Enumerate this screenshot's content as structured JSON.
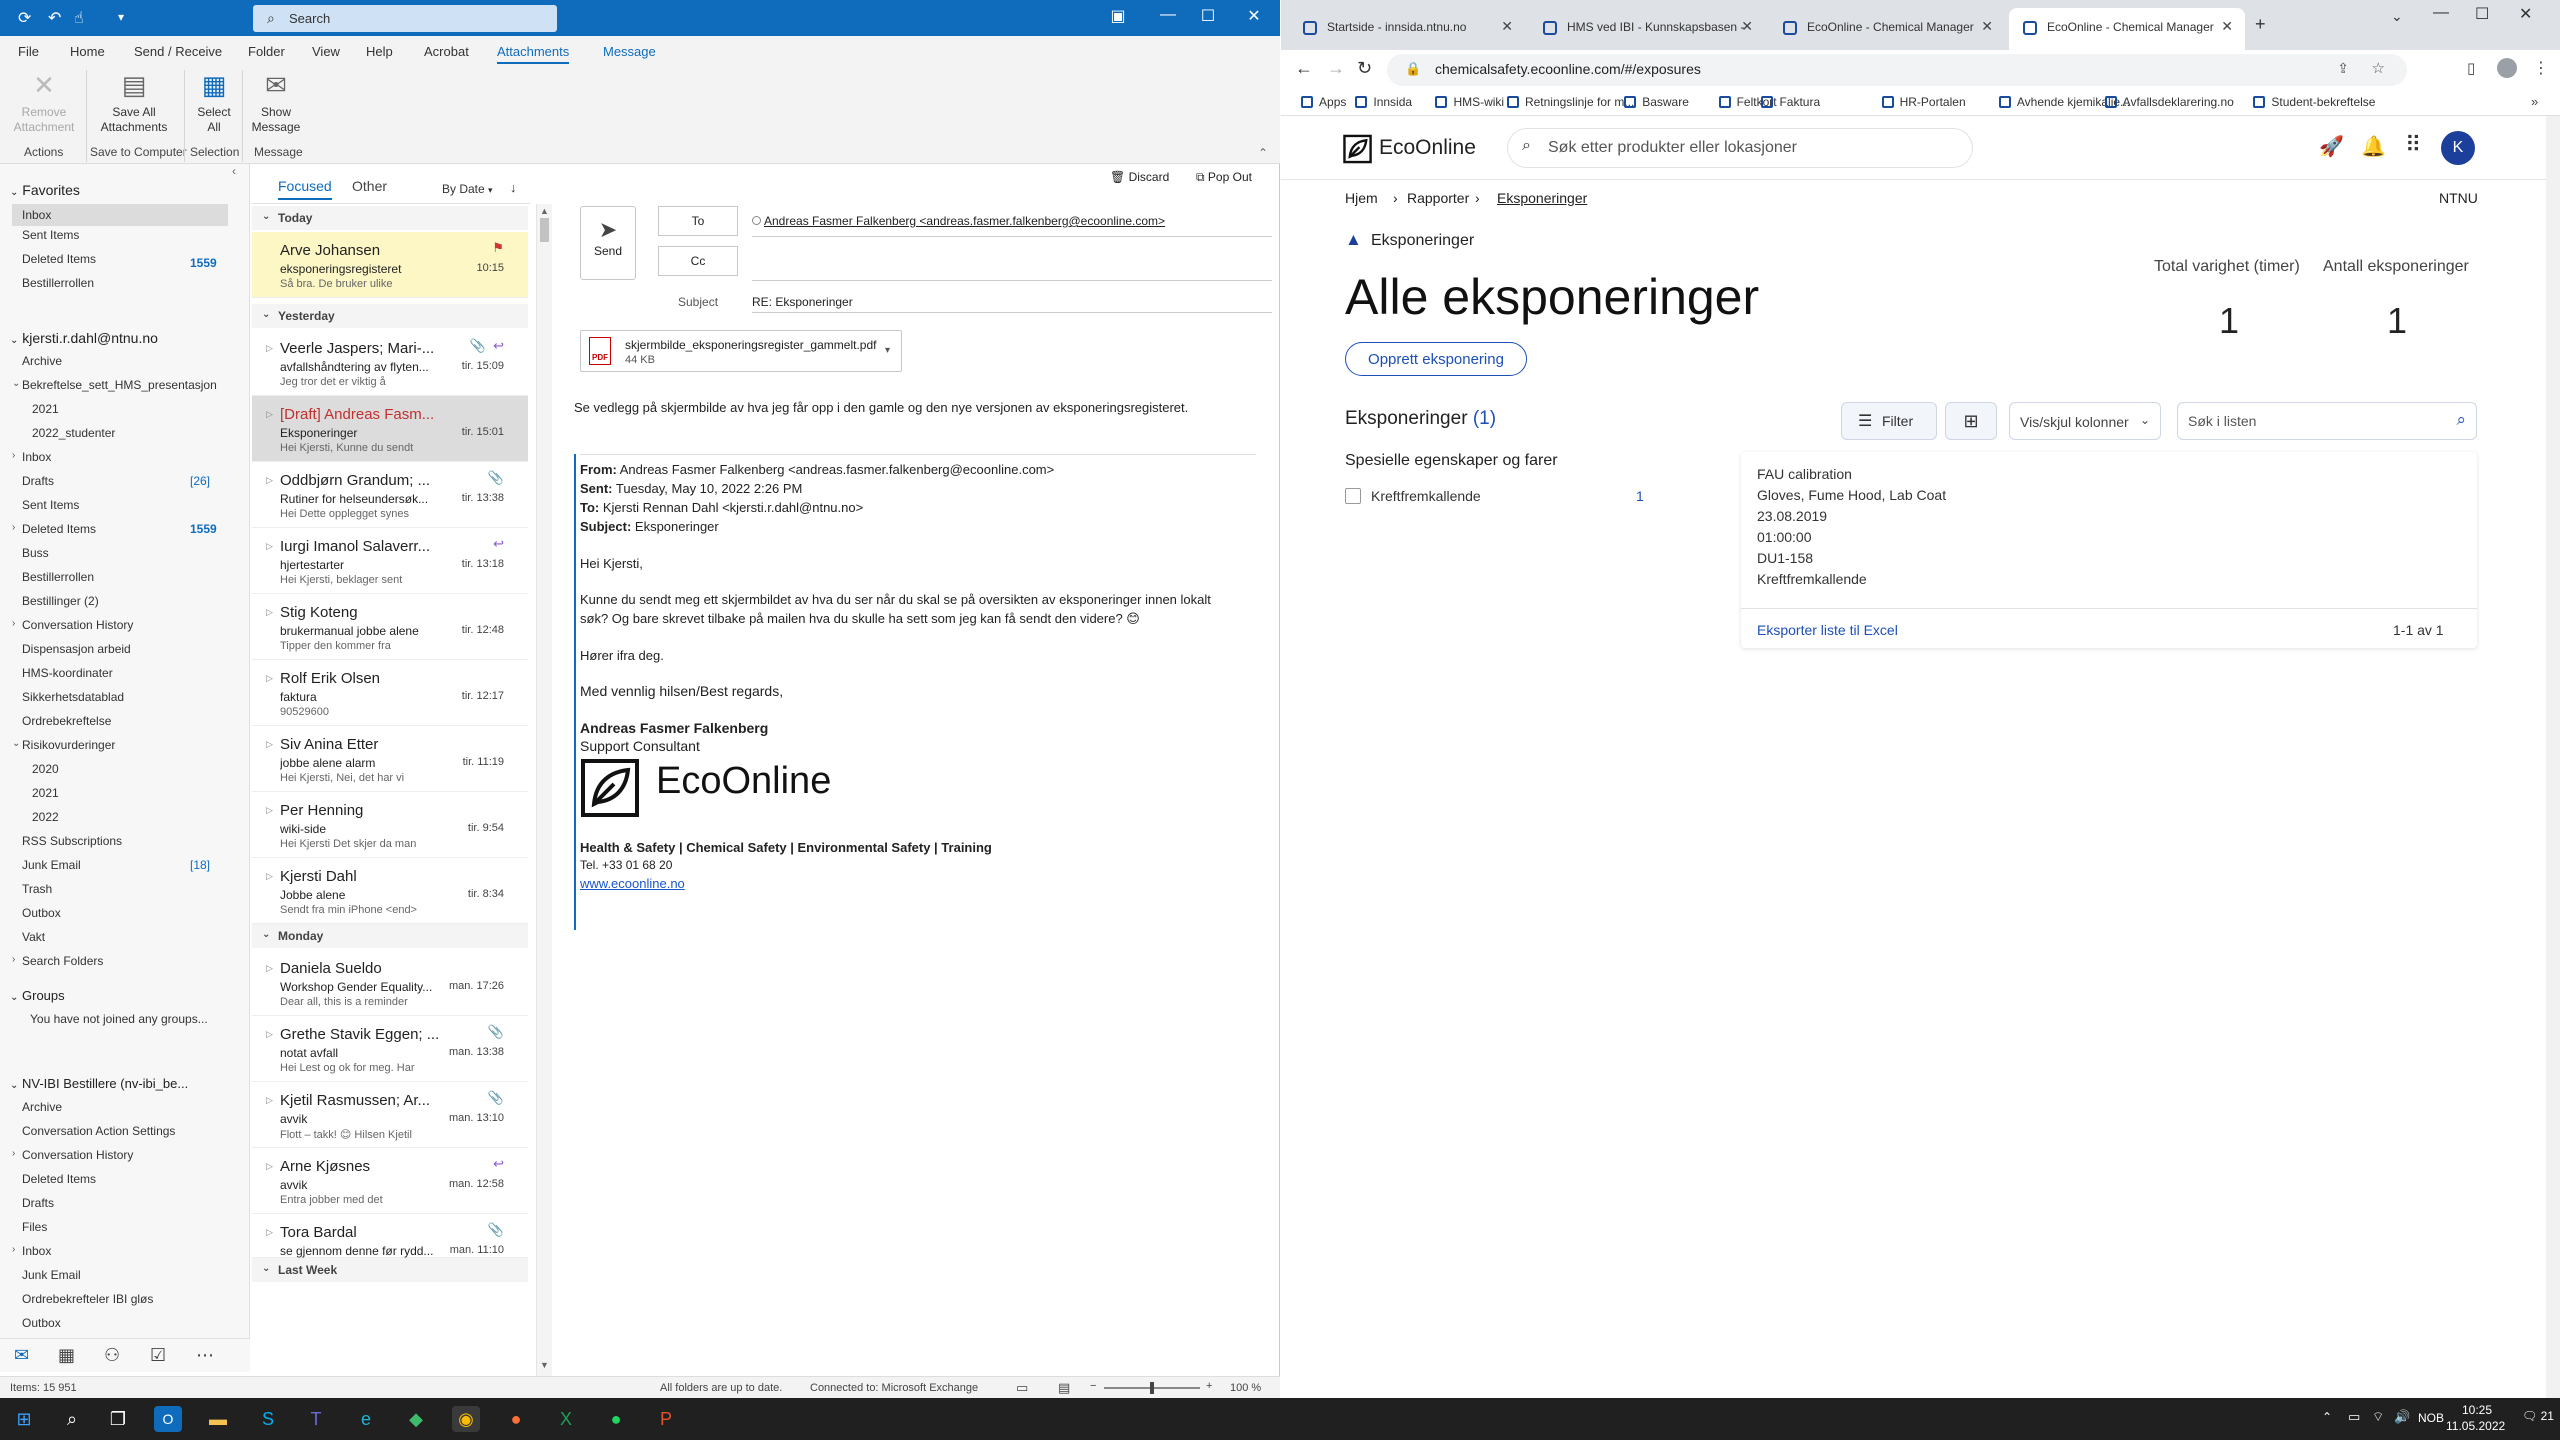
{
  "outlook": {
    "search_placeholder": "Search",
    "menu": [
      "File",
      "Home",
      "Send / Receive",
      "Folder",
      "View",
      "Help",
      "Acrobat",
      "Attachments",
      "Message"
    ],
    "ribbon": {
      "remove_attachment": "Remove\nAttachment",
      "save_all": "Save All\nAttachments",
      "select_all": "Select\nAll",
      "show_message": "Show\nMessage",
      "groups": [
        "Actions",
        "Save to Computer",
        "Selection",
        "Message"
      ]
    },
    "favorites_label": "Favorites",
    "favorites": [
      {
        "label": "Inbox"
      },
      {
        "label": "Sent Items"
      },
      {
        "label": "Deleted Items",
        "count": "1559"
      },
      {
        "label": "Bestillerrollen"
      }
    ],
    "account": "kjersti.r.dahl@ntnu.no",
    "folders": [
      {
        "label": "Archive",
        "indent": 1
      },
      {
        "label": "Bekreftelse_sett_HMS_presentasjon",
        "indent": 1,
        "exp": "v"
      },
      {
        "label": "2021",
        "indent": 2
      },
      {
        "label": "2022_studenter",
        "indent": 2
      },
      {
        "label": "Inbox",
        "indent": 1,
        "exp": ">"
      },
      {
        "label": "Drafts",
        "indent": 1,
        "count": "[26]",
        "bracket": true
      },
      {
        "label": "Sent Items",
        "indent": 1
      },
      {
        "label": "Deleted Items",
        "indent": 1,
        "exp": ">",
        "count": "1559"
      },
      {
        "label": "Buss",
        "indent": 1
      },
      {
        "label": "Bestillerrollen",
        "indent": 1
      },
      {
        "label": "Bestillinger (2)",
        "indent": 1
      },
      {
        "label": "Conversation History",
        "indent": 1,
        "exp": ">"
      },
      {
        "label": "Dispensasjon arbeid",
        "indent": 1
      },
      {
        "label": "HMS-koordinater",
        "indent": 1
      },
      {
        "label": "Sikkerhetsdatablad",
        "indent": 1
      },
      {
        "label": "Ordrebekreftelse",
        "indent": 1
      },
      {
        "label": "Risikovurderinger",
        "indent": 1,
        "exp": "v"
      },
      {
        "label": "2020",
        "indent": 2
      },
      {
        "label": "2021",
        "indent": 2
      },
      {
        "label": "2022",
        "indent": 2
      },
      {
        "label": "RSS Subscriptions",
        "indent": 1
      },
      {
        "label": "Junk Email",
        "indent": 1,
        "count": "[18]",
        "bracket": true
      },
      {
        "label": "Trash",
        "indent": 1
      },
      {
        "label": "Outbox",
        "indent": 1
      },
      {
        "label": "Vakt",
        "indent": 1
      },
      {
        "label": "Search Folders",
        "indent": 1,
        "exp": ">"
      }
    ],
    "groups_label": "Groups",
    "groups_note": "You have not joined any groups...",
    "shared_account": "NV-IBI Bestillere (nv-ibi_be...",
    "shared_folders": [
      {
        "label": "Archive"
      },
      {
        "label": "Conversation Action Settings"
      },
      {
        "label": "Conversation History",
        "exp": ">"
      },
      {
        "label": "Deleted Items"
      },
      {
        "label": "Drafts"
      },
      {
        "label": "Files"
      },
      {
        "label": "Inbox",
        "exp": ">"
      },
      {
        "label": "Junk Email"
      },
      {
        "label": "Ordrebekrefteler IBI gløs"
      },
      {
        "label": "Outbox"
      }
    ],
    "list": {
      "tab_focused": "Focused",
      "tab_other": "Other",
      "sort": "By Date",
      "groups": [
        "Today",
        "Yesterday",
        "Monday",
        "Last Week"
      ],
      "items": [
        {
          "sender": "Arve Johansen",
          "subject": "eksponeringsregisteret",
          "preview": "Så bra. De bruker ulike",
          "time": "10:15",
          "flag": true
        },
        {
          "sender": "Veerle Jaspers;  Mari-...",
          "subject": "avfallshåndtering av flyten...",
          "preview": "Jeg tror det er viktig å",
          "time": "tir. 15:09",
          "att": true,
          "reply": true
        },
        {
          "sender": "[Draft] Andreas Fasm...",
          "subject": "Eksponeringer",
          "preview": "Hei Kjersti,   Kunne du sendt",
          "time": "tir. 15:01",
          "draft": true
        },
        {
          "sender": "Oddbjørn Grandum;  ...",
          "subject": "Rutiner for helseundersøk...",
          "preview": "Hei  Dette opplegget synes",
          "time": "tir. 13:38",
          "att": true
        },
        {
          "sender": "Iurgi Imanol Salaverr...",
          "subject": "hjertestarter",
          "preview": "Hei Kjersti, beklager sent",
          "time": "tir. 13:18",
          "reply": true
        },
        {
          "sender": "Stig Koteng",
          "subject": "brukermanual jobbe alene",
          "preview": "Tipper den kommer fra",
          "time": "tir. 12:48"
        },
        {
          "sender": "Rolf Erik Olsen",
          "subject": "faktura",
          "preview": "90529600",
          "time": "tir. 12:17"
        },
        {
          "sender": "Siv Anina Etter",
          "subject": "jobbe alene alarm",
          "preview": "Hei Kjersti,  Nei, det har vi",
          "time": "tir. 11:19"
        },
        {
          "sender": "Per Henning",
          "subject": "wiki-side",
          "preview": "Hei Kjersti  Det skjer da man",
          "time": "tir. 9:54"
        },
        {
          "sender": "Kjersti Dahl",
          "subject": "Jobbe alene",
          "preview": "Sendt fra min iPhone <end>",
          "time": "tir. 8:34"
        },
        {
          "sender": "Daniela Sueldo",
          "subject": "Workshop Gender Equality...",
          "preview": "Dear all,  this is a reminder",
          "time": "man. 17:26"
        },
        {
          "sender": "Grethe Stavik Eggen; ...",
          "subject": "notat avfall",
          "preview": "Hei  Lest og ok for meg.  Har",
          "time": "man. 13:38",
          "att": true
        },
        {
          "sender": "Kjetil Rasmussen;  Ar...",
          "subject": "avvik",
          "preview": "Flott – takk! 😊  Hilsen Kjetil",
          "time": "man. 13:10",
          "att": true
        },
        {
          "sender": "Arne Kjøsnes",
          "subject": "avvik",
          "preview": "Entra jobber med det",
          "time": "man. 12:58",
          "reply": true
        },
        {
          "sender": "Tora Bardal",
          "subject": "se gjennom denne før rydd...",
          "preview": "",
          "time": "man. 11:10",
          "att": true
        }
      ]
    },
    "reading": {
      "discard": "Discard",
      "popout": "Pop Out",
      "send": "Send",
      "to_btn": "To",
      "cc_btn": "Cc",
      "to_value": "Andreas Fasmer Falkenberg <andreas.fasmer.falkenberg@ecoonline.com>",
      "subject_label": "Subject",
      "subject_value": "RE: Eksponeringer",
      "attachment_name": "skjermbilde_eksponeringsregister_gammelt.pdf",
      "attachment_size": "44 KB",
      "body_line": "Se vedlegg på skjermbilde av hva jeg får opp i den gamle og den nye versjonen av eksponeringsregisteret.",
      "from_label": "From:",
      "from_value": " Andreas Fasmer Falkenberg <andreas.fasmer.falkenberg@ecoonline.com>",
      "sent_label": "Sent:",
      "sent_value": " Tuesday, May 10, 2022 2:26 PM",
      "to_label": "To:",
      "to_value2": " Kjersti Rennan Dahl <kjersti.r.dahl@ntnu.no>",
      "subj_label": "Subject:",
      "subj_value": " Eksponeringer",
      "greeting": "Hei Kjersti,",
      "para1": "Kunne du sendt meg ett skjermbildet av hva du ser når du skal se på oversikten av eksponeringer innen lokalt",
      "para2": "søk? Og bare skrevet tilbake på mailen hva du skulle ha sett som jeg kan få sendt den videre? 😊",
      "hear": "Hører ifra deg.",
      "regards": "Med vennlig hilsen/Best regards,",
      "sig_name": "Andreas Fasmer Falkenberg",
      "sig_title": "Support Consultant",
      "sig_logo": "EcoOnline",
      "sig_tagline": "Health & Safety | Chemical Safety | Environmental Safety | Training",
      "sig_tel": "Tel.    +33 01 68 20",
      "sig_web": "www.ecoonline.no"
    },
    "status": {
      "items": "Items: 15 951",
      "sync": "All folders are up to date.",
      "conn": "Connected to: Microsoft Exchange",
      "zoom": "100 %"
    }
  },
  "chrome": {
    "tabs": [
      {
        "title": "Startside - innsida.ntnu.no"
      },
      {
        "title": "HMS ved IBI - Kunnskapsbasen -"
      },
      {
        "title": "EcoOnline - Chemical Manager"
      },
      {
        "title": "EcoOnline - Chemical Manager",
        "active": true
      }
    ],
    "url": "chemicalsafety.ecoonline.com/#/exposures",
    "bookmarks": [
      "Apps",
      "Innsida",
      "HMS-wiki",
      "Retningslinje for m...",
      "Basware",
      "Feltkort",
      "Faktura",
      "HR-Portalen",
      "Avhende kjemikalie...",
      "Avfallsdeklarering.no",
      "Student-bekreftelse"
    ]
  },
  "eco": {
    "logo": "EcoOnline",
    "search_placeholder": "Søk etter produkter eller lokasjoner",
    "avatar": "K",
    "breadcrumb": [
      "Hjem",
      "Rapporter",
      "Eksponeringer"
    ],
    "org": "NTNU",
    "section_label": "Eksponeringer",
    "page_title": "Alle eksponeringer",
    "stat1_label": "Total varighet (timer)",
    "stat1_value": "1",
    "stat2_label": "Antall eksponeringer",
    "stat2_value": "1",
    "create_btn": "Opprett eksponering",
    "list_title": "Eksponeringer",
    "list_count": "(1)",
    "filter_btn": "Filter",
    "columns_select": "Vis/skjul kolonner",
    "list_search_placeholder": "Søk i listen",
    "props_title": "Spesielle egenskaper og farer",
    "props": [
      {
        "label": "Kreftfremkallende",
        "count": "1"
      }
    ],
    "card": [
      "FAU calibration",
      "Gloves, Fume Hood, Lab Coat",
      "23.08.2019",
      "01:00:00",
      " DU1-158",
      "Kreftfremkallende"
    ],
    "export": "Eksporter liste til Excel",
    "paging": "1-1 av 1"
  },
  "taskbar": {
    "lang": "NOB",
    "time": "10:25",
    "date": "11.05.2022",
    "notif": "21"
  }
}
